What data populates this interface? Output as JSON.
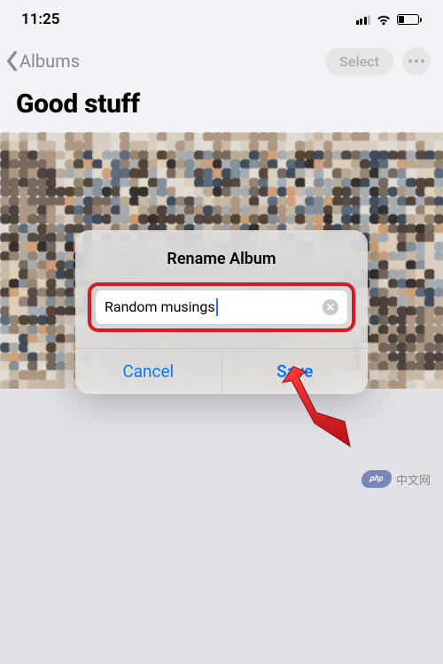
{
  "statusBar": {
    "time": "11:25"
  },
  "nav": {
    "backLabel": "Albums",
    "selectLabel": "Select"
  },
  "album": {
    "title": "Good stuff"
  },
  "dialog": {
    "title": "Rename Album",
    "inputValue": "Random musings",
    "cancelLabel": "Cancel",
    "saveLabel": "Save"
  },
  "watermark": {
    "badge": "php",
    "text": "中文网"
  },
  "colors": {
    "accent": "#007aff",
    "highlight": "#d31c23",
    "arrow": "#e3262d"
  }
}
